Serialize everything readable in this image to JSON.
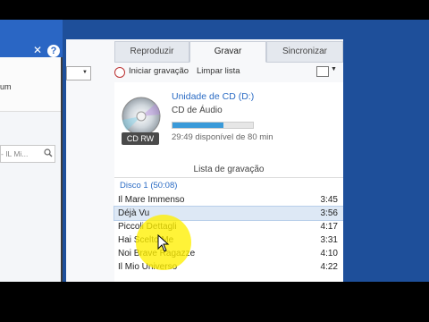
{
  "left_window": {
    "ribbon_text": "um",
    "search_text": "- IL Mi...",
    "close_glyph": "✕",
    "help_glyph": "?"
  },
  "tabs": [
    {
      "label": "Reproduzir",
      "active": false
    },
    {
      "label": "Gravar",
      "active": true
    },
    {
      "label": "Sincronizar",
      "active": false
    }
  ],
  "toolbar": {
    "burn_label": "Iniciar gravação",
    "clear_label": "Limpar lista",
    "options_icon": "burn-options-icon"
  },
  "drive": {
    "name": "Unidade de CD (D:)",
    "type": "CD de Áudio",
    "icon_label": "CD RW",
    "free_text": "29:49 disponível de 80 min",
    "used_fraction": 0.63
  },
  "burn_list": {
    "title": "Lista de gravação",
    "disc_label": "Disco 1 (50:08)",
    "tracks": [
      {
        "title": "Il Mare Immenso",
        "duration": "3:45",
        "selected": false
      },
      {
        "title": "Déjà Vu",
        "duration": "3:56",
        "selected": true
      },
      {
        "title": "Piccoli Dettagli",
        "duration": "4:17",
        "selected": false
      },
      {
        "title": "Hai Scelto Me",
        "duration": "3:31",
        "selected": false
      },
      {
        "title": "Noi Brave Ragazze",
        "duration": "4:10",
        "selected": false
      },
      {
        "title": "Il Mio Universo",
        "duration": "4:22",
        "selected": false
      }
    ]
  },
  "colors": {
    "desktop_blue": "#1e4f9a",
    "link_blue": "#2a6bc4",
    "highlight_yellow": "#fff000"
  }
}
